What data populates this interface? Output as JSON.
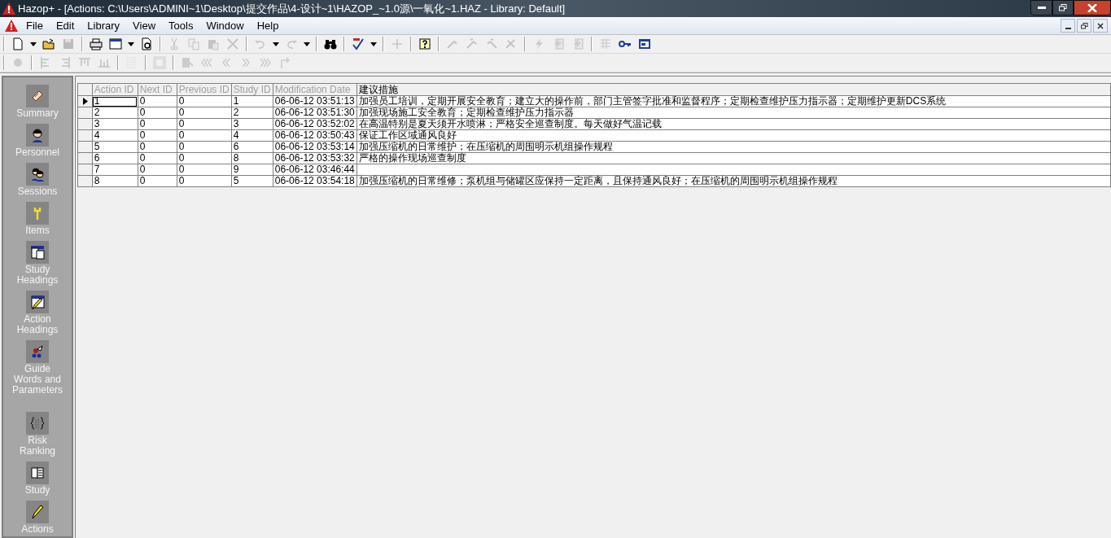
{
  "window": {
    "title": "Hazop+ - [Actions: C:\\Users\\ADMINI~1\\Desktop\\提交作品\\4-设计~1\\HAZOP_~1.0源\\一氧化~1.HAZ - Library: Default]"
  },
  "menu": [
    "File",
    "Edit",
    "Library",
    "View",
    "Tools",
    "Window",
    "Help"
  ],
  "toolbars": [
    {
      "items": [
        {
          "kind": "button",
          "disabled": false
        },
        {
          "kind": "dropdown",
          "disabled": false
        },
        {
          "kind": "button",
          "disabled": false
        },
        {
          "kind": "button",
          "disabled": true
        },
        {
          "kind": "separator"
        },
        {
          "kind": "button",
          "disabled": false
        },
        {
          "kind": "button",
          "disabled": false
        },
        {
          "kind": "dropdown",
          "disabled": false
        },
        {
          "kind": "button",
          "disabled": false
        },
        {
          "kind": "separator"
        },
        {
          "kind": "button",
          "disabled": true
        },
        {
          "kind": "button",
          "disabled": true
        },
        {
          "kind": "button",
          "disabled": true
        },
        {
          "kind": "button",
          "disabled": true
        },
        {
          "kind": "separator"
        },
        {
          "kind": "button",
          "disabled": true
        },
        {
          "kind": "dropdown",
          "disabled": false
        },
        {
          "kind": "button",
          "disabled": true
        },
        {
          "kind": "dropdown",
          "disabled": false
        },
        {
          "kind": "separator"
        },
        {
          "kind": "button",
          "disabled": false
        },
        {
          "kind": "separator"
        },
        {
          "kind": "button",
          "disabled": false
        },
        {
          "kind": "dropdown",
          "disabled": false
        },
        {
          "kind": "separator"
        },
        {
          "kind": "button",
          "disabled": true
        },
        {
          "kind": "separator"
        },
        {
          "kind": "button",
          "disabled": false
        },
        {
          "kind": "separator"
        },
        {
          "kind": "button",
          "disabled": true
        },
        {
          "kind": "button",
          "disabled": true
        },
        {
          "kind": "button",
          "disabled": true
        },
        {
          "kind": "button",
          "disabled": true
        },
        {
          "kind": "separator"
        },
        {
          "kind": "button",
          "disabled": true
        },
        {
          "kind": "button",
          "disabled": true
        },
        {
          "kind": "button",
          "disabled": true
        },
        {
          "kind": "separator"
        },
        {
          "kind": "button",
          "disabled": true
        },
        {
          "kind": "button",
          "disabled": false
        },
        {
          "kind": "button",
          "disabled": false
        }
      ]
    },
    {
      "items": [
        {
          "kind": "button",
          "disabled": true
        },
        {
          "kind": "separator"
        },
        {
          "kind": "button",
          "disabled": true
        },
        {
          "kind": "button",
          "disabled": true
        },
        {
          "kind": "button",
          "disabled": true
        },
        {
          "kind": "button",
          "disabled": true
        },
        {
          "kind": "separator"
        },
        {
          "kind": "button",
          "disabled": true
        },
        {
          "kind": "separator"
        },
        {
          "kind": "button",
          "disabled": true
        },
        {
          "kind": "separator"
        },
        {
          "kind": "button",
          "disabled": true
        },
        {
          "kind": "button",
          "disabled": true
        },
        {
          "kind": "button",
          "disabled": true
        },
        {
          "kind": "button",
          "disabled": true
        },
        {
          "kind": "button",
          "disabled": true
        },
        {
          "kind": "button",
          "disabled": true
        }
      ]
    }
  ],
  "sidebar": {
    "items": [
      {
        "label": "Summary"
      },
      {
        "label": "Personnel"
      },
      {
        "label": "Sessions"
      },
      {
        "label": "Items"
      },
      {
        "label": "Study Headings"
      },
      {
        "label": "Action Headings"
      },
      {
        "label": "Guide Words and Parameters"
      },
      {
        "label": "Risk Ranking"
      },
      {
        "label": "Study"
      },
      {
        "label": "Actions"
      }
    ]
  },
  "table": {
    "columns": [
      {
        "label": "Action ID",
        "disabled": true
      },
      {
        "label": "Next ID",
        "disabled": true
      },
      {
        "label": "Previous ID",
        "disabled": true
      },
      {
        "label": "Study ID",
        "disabled": true
      },
      {
        "label": "Modification Date",
        "disabled": true
      },
      {
        "label": "建议措施",
        "disabled": false
      }
    ],
    "rows": [
      {
        "selected": true,
        "cells": [
          "1",
          "0",
          "0",
          "1",
          "06-06-12 03:51:13",
          "加强员工培训，定期开展安全教育；建立大的操作前，部门主管签字批准和监督程序；定期检查维护压力指示器；定期维护更新DCS系统"
        ]
      },
      {
        "selected": false,
        "cells": [
          "2",
          "0",
          "0",
          "2",
          "06-06-12 03:51:30",
          "加强现场施工安全教育；定期检查维护压力指示器"
        ]
      },
      {
        "selected": false,
        "cells": [
          "3",
          "0",
          "0",
          "3",
          "06-06-12 03:52:02",
          "在高温特别是夏天须开水喷淋；严格安全巡查制度。每天做好气温记载"
        ]
      },
      {
        "selected": false,
        "cells": [
          "4",
          "0",
          "0",
          "4",
          "06-06-12 03:50:43",
          "保证工作区域通风良好"
        ]
      },
      {
        "selected": false,
        "cells": [
          "5",
          "0",
          "0",
          "6",
          "06-06-12 03:53:14",
          "加强压缩机的日常维护；在压缩机的周围明示机组操作规程"
        ]
      },
      {
        "selected": false,
        "cells": [
          "6",
          "0",
          "0",
          "8",
          "06-06-12 03:53:32",
          "严格的操作现场巡查制度"
        ]
      },
      {
        "selected": false,
        "cells": [
          "7",
          "0",
          "0",
          "9",
          "06-06-12 03:46:44"
        ]
      },
      {
        "selected": false,
        "cells": [
          "8",
          "0",
          "0",
          "5",
          "06-06-12 03:54:18",
          "加强压缩机的日常维修；泵机组与储罐区应保持一定距离，且保持通风良好；在压缩机的周围明示机组操作规程"
        ]
      }
    ]
  }
}
